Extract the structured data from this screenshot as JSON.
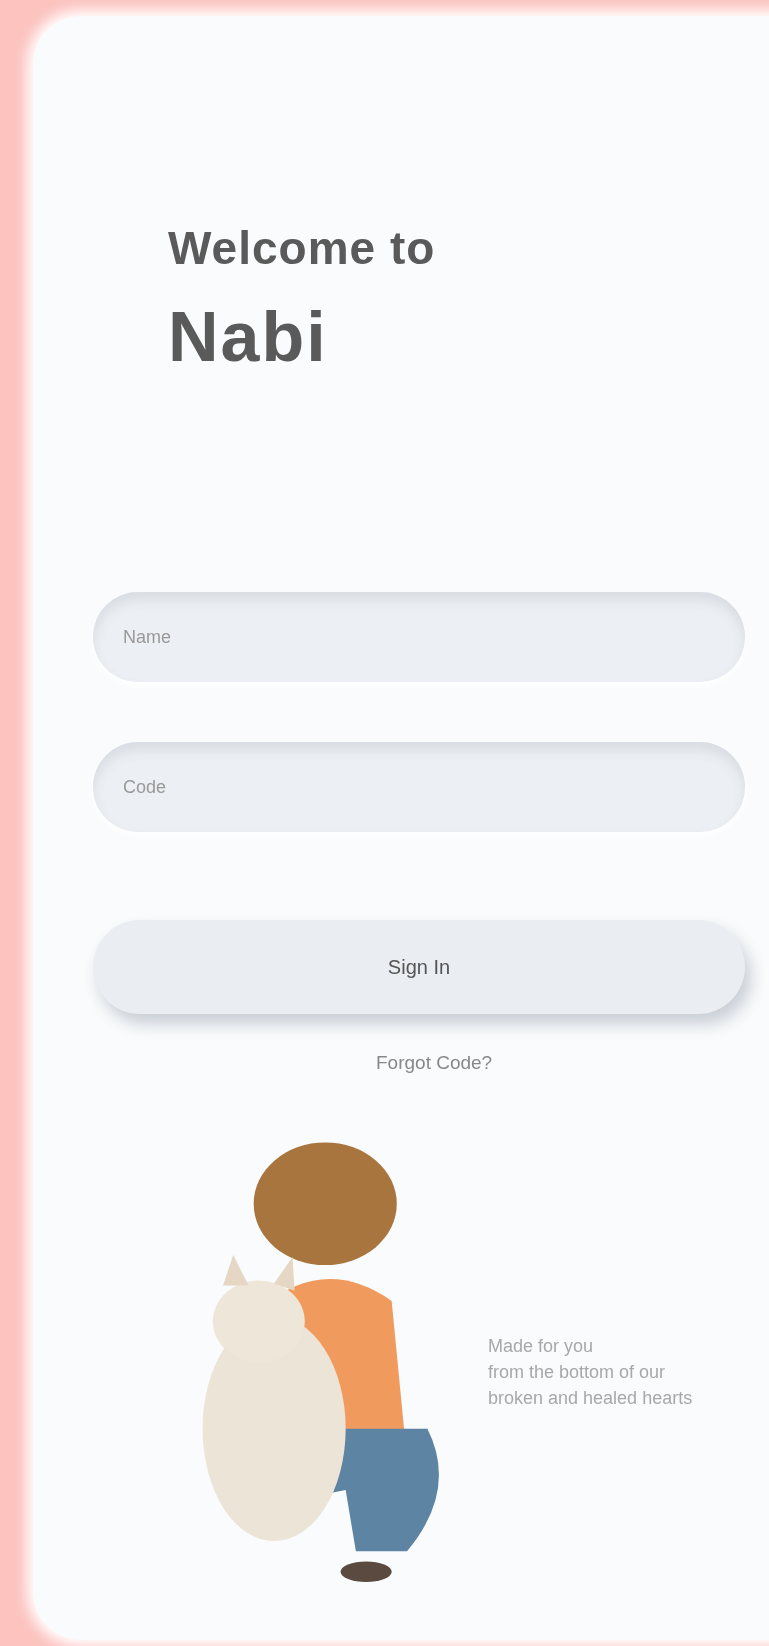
{
  "heading": {
    "greeting": "Welcome to",
    "app_name": "Nabi"
  },
  "fields": [
    {
      "placeholder": "Name"
    },
    {
      "placeholder": "Code"
    }
  ],
  "sign_in_button": "Sign In",
  "forgot_link": "Forgot Code?",
  "tagline": [
    "Made for you",
    "from the bottom of our",
    "broken and healed hearts"
  ]
}
